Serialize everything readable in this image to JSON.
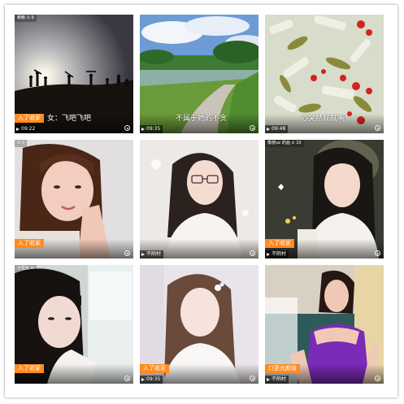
{
  "tiles": [
    {
      "topmeta": "赖赖  ⊙ 9",
      "tag": "入了收家",
      "title": "女：飞吧飞吧",
      "duration": "09:22"
    },
    {
      "topmeta": "",
      "tag": "",
      "title": "不属于她的不贪",
      "duration": "09:35"
    },
    {
      "topmeta": "",
      "tag": "",
      "title": "心突然就就啊",
      "duration": "09:48"
    },
    {
      "topmeta": "  ⊙ 0",
      "tag": "入了收家",
      "title": "",
      "duration": ""
    },
    {
      "topmeta": "",
      "tag": "不陌村",
      "title": "",
      "duration": ""
    },
    {
      "topmeta": "像使ue 的画 ⊙ 10",
      "tag": "入了收家",
      "title": "",
      "duration": "不陌村"
    },
    {
      "topmeta": "小花女  ⊙",
      "tag": "入了收家",
      "title": "",
      "duration": ""
    },
    {
      "topmeta": "",
      "tag": "入了收家",
      "title": "",
      "duration": "09:35"
    },
    {
      "topmeta": "",
      "tag": "口更光颜值",
      "title": "",
      "duration": "不陌村"
    }
  ]
}
